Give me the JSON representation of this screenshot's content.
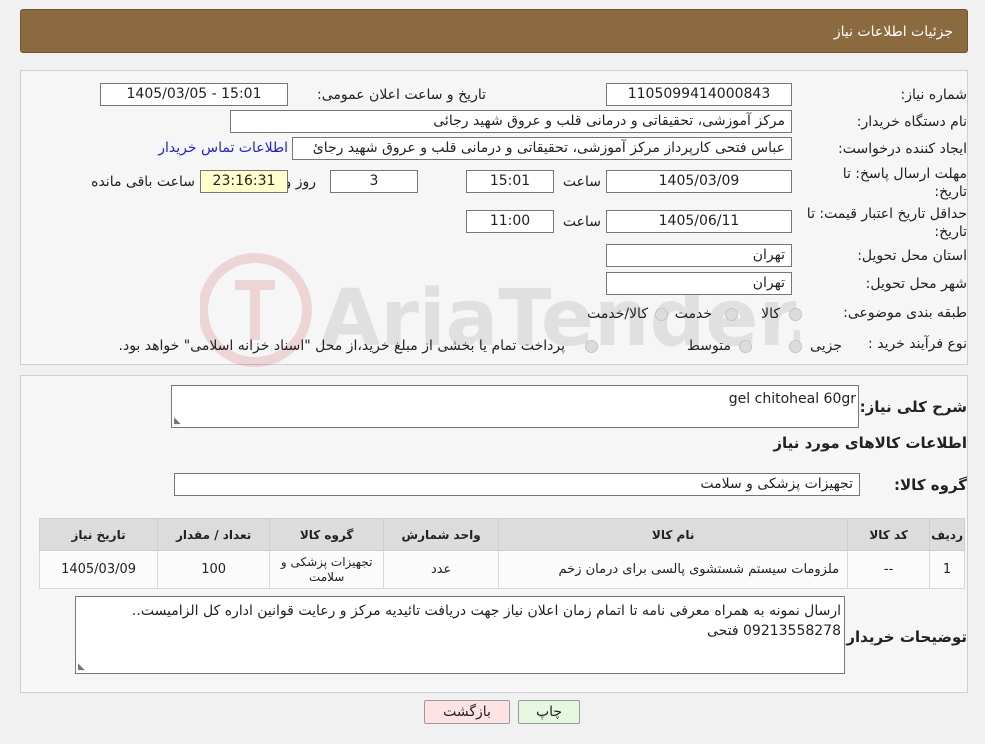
{
  "header": {
    "title": "جزئیات اطلاعات نیاز"
  },
  "watermark": {
    "text": "AriaTender.neT"
  },
  "form": {
    "need_number_label": "شماره نیاز:",
    "need_number": "1105099414000843",
    "announce_label": "تاریخ و ساعت اعلان عمومی:",
    "announce_value": "1405/03/05 - 15:01",
    "buyer_label": "نام دستگاه خریدار:",
    "buyer_value": "مرکز آموزشی، تحقیقاتی و درمانی قلب و عروق شهید رجائی",
    "creator_label": "ایجاد کننده درخواست:",
    "creator_value": "عباس فتحی کارپرداز مرکز آموزشی، تحقیقاتی و درمانی قلب و عروق شهید رجائ",
    "contact_link": "اطلاعات تماس خریدار",
    "deadline_label_1": "مهلت ارسال پاسخ: تا",
    "deadline_label_2": "تاریخ:",
    "deadline_date": "1405/03/09",
    "time_label": "ساعت",
    "deadline_time": "15:01",
    "days_value": "3",
    "days_label": "روز و",
    "remaining_time": "23:16:31",
    "remaining_label": "ساعت باقی مانده",
    "validity_label_1": "حداقل تاریخ اعتبار قیمت: تا",
    "validity_label_2": "تاریخ:",
    "validity_date": "1405/06/11",
    "validity_time": "11:00",
    "province_label": "استان محل تحویل:",
    "province_value": "تهران",
    "city_label": "شهر محل تحویل:",
    "city_value": "تهران",
    "category_label": "طبقه بندی موضوعی:",
    "category_options": [
      "کالا",
      "خدمت",
      "کالا/خدمت"
    ],
    "process_label": "نوع فرآیند خرید :",
    "process_options": [
      "جزیی",
      "متوسط"
    ],
    "process_note": "پرداخت تمام یا بخشی از مبلغ خرید،از محل \"اسناد خزانه اسلامی\" خواهد بود."
  },
  "summary": {
    "label": "شرح کلی نیاز:",
    "value": "gel chitoheal 60gr",
    "items_title": "اطلاعات کالاهای مورد نیاز",
    "group_label": "گروه کالا:",
    "group_value": "تجهیزات پزشکی و سلامت"
  },
  "table": {
    "headers": [
      "ردیف",
      "کد کالا",
      "نام کالا",
      "واحد شمارش",
      "گروه کالا",
      "تعداد / مقدار",
      "تاریخ نیاز"
    ],
    "rows": [
      [
        "1",
        "--",
        "ملزومات سیستم شستشوی پالسی برای درمان زخم",
        "عدد",
        "تجهیزات پزشکی و سلامت",
        "100",
        "1405/03/09"
      ]
    ]
  },
  "buyer_notes": {
    "label": "توضیحات خریدار:",
    "value": "ارسال نمونه به همراه معرفی نامه تا اتمام زمان اعلان نیاز جهت دریافت تائیدیه مرکز و رعایت قوانین اداره کل الزامیست.. 09213558278 فتحی"
  },
  "buttons": {
    "print": "چاپ",
    "back": "بازگشت"
  },
  "colors": {
    "header_bg": "#8c6a3f",
    "link": "#2222cc",
    "back_bg": "#fde3e3",
    "print_bg": "#e6f7e0"
  }
}
